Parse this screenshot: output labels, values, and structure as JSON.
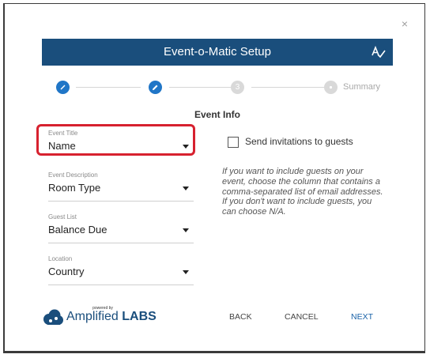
{
  "dialog": {
    "title": "Event-o-Matic Setup",
    "close_label": "×"
  },
  "stepper": {
    "step3_number": "3",
    "summary_label": "Summary",
    "colors": {
      "done": "#2076c7",
      "todo": "#d9d9d9"
    }
  },
  "section_title": "Event Info",
  "fields": [
    {
      "label": "Event Title",
      "value": "Name"
    },
    {
      "label": "Event Description",
      "value": "Room Type"
    },
    {
      "label": "Guest List",
      "value": "Balance Due"
    },
    {
      "label": "Location",
      "value": "Country"
    }
  ],
  "invite": {
    "label": "Send invitations to guests",
    "checked": false,
    "help_text": "If you want to include guests on your event, choose the column that contains a comma-separated list of email addresses. If you don't want to include guests, you can choose N/A."
  },
  "logo": {
    "powered_by": "powered by",
    "brand_light": "Amplified",
    "brand_bold": "LABS"
  },
  "footer": {
    "back": "BACK",
    "cancel": "CANCEL",
    "next": "NEXT"
  },
  "colors": {
    "header": "#1a4e7c",
    "accent": "#2076c7",
    "highlight": "#d7212f"
  }
}
